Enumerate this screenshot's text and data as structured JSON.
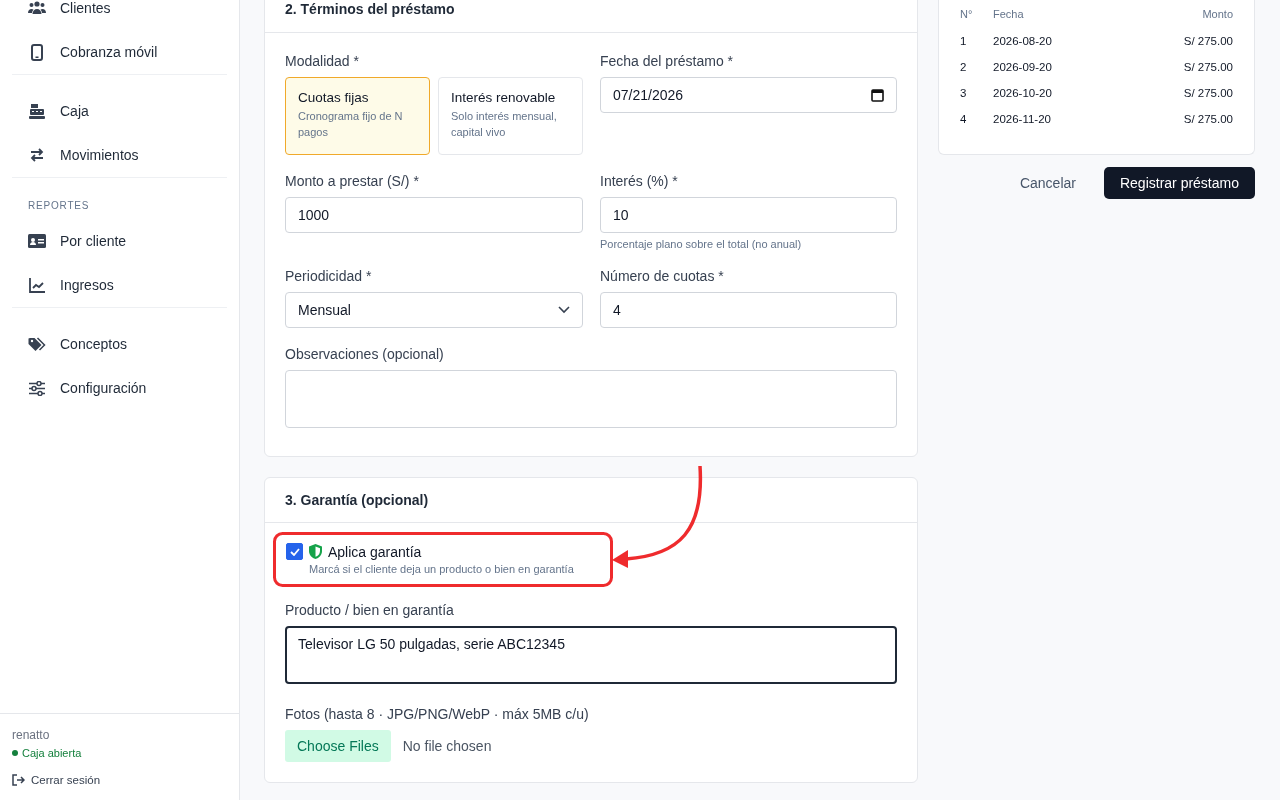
{
  "sidebar": {
    "groups": [
      {
        "items": [
          {
            "label": "Clientes"
          },
          {
            "label": "Cobranza móvil"
          }
        ]
      },
      {
        "items": [
          {
            "label": "Caja"
          },
          {
            "label": "Movimientos"
          }
        ]
      },
      {
        "heading": "REPORTES",
        "items": [
          {
            "label": "Por cliente"
          },
          {
            "label": "Ingresos"
          }
        ]
      },
      {
        "items": [
          {
            "label": "Conceptos"
          },
          {
            "label": "Configuración"
          }
        ]
      }
    ],
    "user": "renatto",
    "status": {
      "label": "Caja abierta",
      "color": "#15803d"
    },
    "logout": "Cerrar sesión"
  },
  "terms": {
    "title": "2. Términos del préstamo",
    "modalidad": {
      "label": "Modalidad *",
      "options": [
        {
          "title": "Cuotas fijas",
          "description": "Cronograma fijo de N pagos",
          "selected": true
        },
        {
          "title": "Interés renovable",
          "description": "Solo interés mensual, capital vivo",
          "selected": false
        }
      ]
    },
    "fecha": {
      "label": "Fecha del préstamo *",
      "value": "07/21/2026"
    },
    "monto": {
      "label": "Monto a prestar (S/) *",
      "value": "1000"
    },
    "interes": {
      "label": "Interés (%) *",
      "value": "10",
      "hint": "Porcentaje plano sobre el total (no anual)"
    },
    "periodicidad": {
      "label": "Periodicidad *",
      "value": "Mensual"
    },
    "cuotas": {
      "label": "Número de cuotas *",
      "value": "4"
    },
    "observaciones": {
      "label": "Observaciones (opcional)"
    }
  },
  "guarantee": {
    "title": "3. Garantía (opcional)",
    "checkbox": {
      "label": "Aplica garantía",
      "hint": "Marcá si el cliente deja un producto o bien en garantía",
      "checked": true
    },
    "producto": {
      "label": "Producto / bien en garantía",
      "value": "Televisor LG 50 pulgadas, serie ABC12345"
    },
    "fotos": {
      "label": "Fotos (hasta 8 · JPG/PNG/WebP · máx 5MB c/u)",
      "button": "Choose Files",
      "status": "No file chosen"
    }
  },
  "schedule": {
    "columns": [
      "N°",
      "Fecha",
      "Monto"
    ],
    "rows": [
      [
        "1",
        "2026-08-20",
        "S/ 275.00"
      ],
      [
        "2",
        "2026-09-20",
        "S/ 275.00"
      ],
      [
        "3",
        "2026-10-20",
        "S/ 275.00"
      ],
      [
        "4",
        "2026-11-20",
        "S/ 275.00"
      ]
    ]
  },
  "actions": {
    "cancel": "Cancelar",
    "submit": "Registrar préstamo"
  }
}
